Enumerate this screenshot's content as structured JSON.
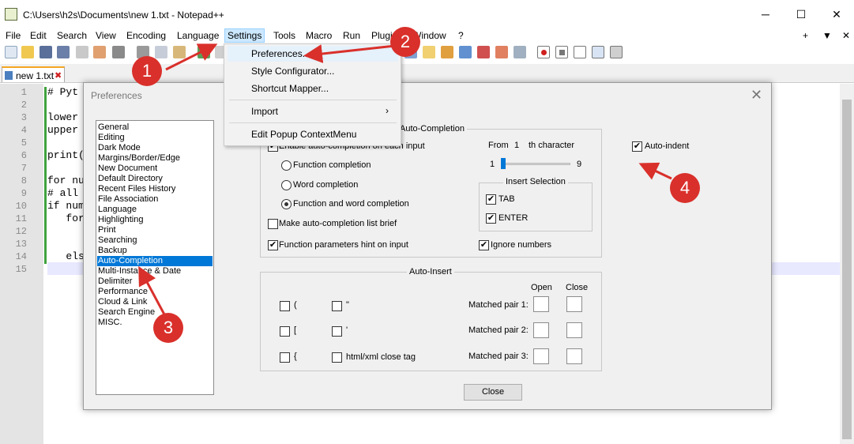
{
  "window": {
    "title": "C:\\Users\\h2s\\Documents\\new 1.txt - Notepad++",
    "minimize": "─",
    "maximize": "☐",
    "close": "✕"
  },
  "menubar": {
    "items": [
      "File",
      "Edit",
      "Search",
      "View",
      "Encoding",
      "Language",
      "Settings",
      "Tools",
      "Macro",
      "Run",
      "Plugins",
      "Window",
      "?"
    ],
    "right": [
      "+",
      "▼",
      "✕"
    ]
  },
  "tab": {
    "label": "new 1.txt"
  },
  "editor": {
    "line_numbers": [
      "1",
      "2",
      "3",
      "4",
      "5",
      "6",
      "7",
      "8",
      "9",
      "10",
      "11",
      "12",
      "13",
      "14",
      "15"
    ],
    "lines": [
      "# Pyt",
      "",
      "lower",
      "upper",
      "",
      "print(",
      "",
      "for nu",
      "# all",
      "if num",
      "   for",
      "",
      "",
      "   els",
      ""
    ]
  },
  "settings_menu": {
    "items": [
      "Preferences...",
      "Style Configurator...",
      "Shortcut Mapper...",
      "Import",
      "Edit Popup ContextMenu"
    ]
  },
  "dialog": {
    "title": "Preferences",
    "close": "✕",
    "categories": [
      "General",
      "Editing",
      "Dark Mode",
      "Margins/Border/Edge",
      "New Document",
      "Default Directory",
      "Recent Files History",
      "File Association",
      "Language",
      "Highlighting",
      "Print",
      "Searching",
      "Backup",
      "Auto-Completion",
      "Multi-Instance & Date",
      "Delimiter",
      "Performance",
      "Cloud & Link",
      "Search Engine",
      "MISC."
    ],
    "selected_category": "Auto-Completion",
    "auto_completion": {
      "group_label": "Auto-Completion",
      "enable_label": "Enable auto-completion on each input",
      "radios": [
        "Function completion",
        "Word completion",
        "Function and word completion"
      ],
      "selected_radio": "Function and word completion",
      "from_label": "From",
      "from_value": "1",
      "th_label": "th character",
      "slider_min": "1",
      "slider_max": "9",
      "slider_value": 1,
      "insert_selection_label": "Insert Selection",
      "tab_label": "TAB",
      "enter_label": "ENTER",
      "brief_label": "Make auto-completion list brief",
      "params_hint_label": "Function parameters hint on input",
      "ignore_numbers_label": "Ignore numbers",
      "auto_indent_label": "Auto-indent"
    },
    "auto_insert": {
      "group_label": "Auto-Insert",
      "open_label": "Open",
      "close_label": "Close",
      "chars": [
        "(",
        "[",
        "{"
      ],
      "quote_chars": [
        "\"",
        "'"
      ],
      "html_label": "html/xml close tag",
      "pairs": [
        "Matched pair 1:",
        "Matched pair 2:",
        "Matched pair 3:"
      ]
    },
    "close_button": "Close"
  },
  "annotations": {
    "step1": "1",
    "step2": "2",
    "step3": "3",
    "step4": "4",
    "color": "#d9302b"
  }
}
